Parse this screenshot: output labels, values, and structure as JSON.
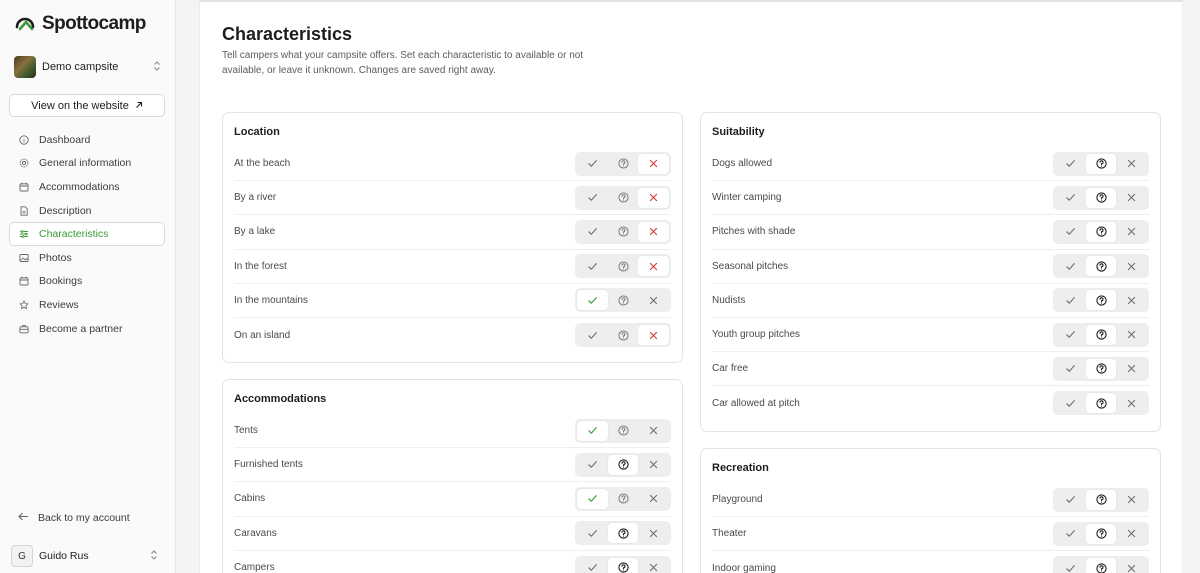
{
  "app": {
    "logo_text": "Spottocamp"
  },
  "campsite": {
    "name": "Demo campsite"
  },
  "sidebar": {
    "view_button": "View on the website",
    "items": [
      {
        "label": "Dashboard",
        "icon": "info-icon",
        "active": false
      },
      {
        "label": "General information",
        "icon": "gear-icon",
        "active": false
      },
      {
        "label": "Accommodations",
        "icon": "calendar-icon",
        "active": false
      },
      {
        "label": "Description",
        "icon": "document-icon",
        "active": false
      },
      {
        "label": "Characteristics",
        "icon": "sliders-icon",
        "active": true
      },
      {
        "label": "Photos",
        "icon": "image-icon",
        "active": false
      },
      {
        "label": "Bookings",
        "icon": "calendar-icon",
        "active": false
      },
      {
        "label": "Reviews",
        "icon": "star-icon",
        "active": false
      },
      {
        "label": "Become a partner",
        "icon": "briefcase-icon",
        "active": false
      }
    ],
    "back_label": "Back to my account",
    "user": {
      "initial": "G",
      "name": "Guido Rus"
    }
  },
  "page": {
    "title": "Characteristics",
    "description": "Tell campers what your campsite offers. Set each characteristic to available or not available, or leave it unknown. Changes are saved right away."
  },
  "colors": {
    "accent_green": "#3a9a3a",
    "no_red": "#d23a3a",
    "neutral_icon": "#6f6f6f"
  },
  "sections": {
    "location": {
      "title": "Location",
      "rows": [
        {
          "label": "At the beach",
          "state": "no"
        },
        {
          "label": "By a river",
          "state": "no"
        },
        {
          "label": "By a lake",
          "state": "no"
        },
        {
          "label": "In the forest",
          "state": "no"
        },
        {
          "label": "In the mountains",
          "state": "yes"
        },
        {
          "label": "On an island",
          "state": "no"
        }
      ]
    },
    "accommodations": {
      "title": "Accommodations",
      "rows": [
        {
          "label": "Tents",
          "state": "yes"
        },
        {
          "label": "Furnished tents",
          "state": "unknown"
        },
        {
          "label": "Cabins",
          "state": "yes"
        },
        {
          "label": "Caravans",
          "state": "unknown"
        },
        {
          "label": "Campers",
          "state": "unknown"
        }
      ]
    },
    "suitability": {
      "title": "Suitability",
      "rows": [
        {
          "label": "Dogs allowed",
          "state": "unknown"
        },
        {
          "label": "Winter camping",
          "state": "unknown"
        },
        {
          "label": "Pitches with shade",
          "state": "unknown"
        },
        {
          "label": "Seasonal pitches",
          "state": "unknown"
        },
        {
          "label": "Nudists",
          "state": "unknown"
        },
        {
          "label": "Youth group pitches",
          "state": "unknown"
        },
        {
          "label": "Car free",
          "state": "unknown"
        },
        {
          "label": "Car allowed at pitch",
          "state": "unknown"
        }
      ]
    },
    "recreation": {
      "title": "Recreation",
      "rows": [
        {
          "label": "Playground",
          "state": "unknown"
        },
        {
          "label": "Theater",
          "state": "unknown"
        },
        {
          "label": "Indoor gaming",
          "state": "unknown"
        }
      ]
    }
  }
}
